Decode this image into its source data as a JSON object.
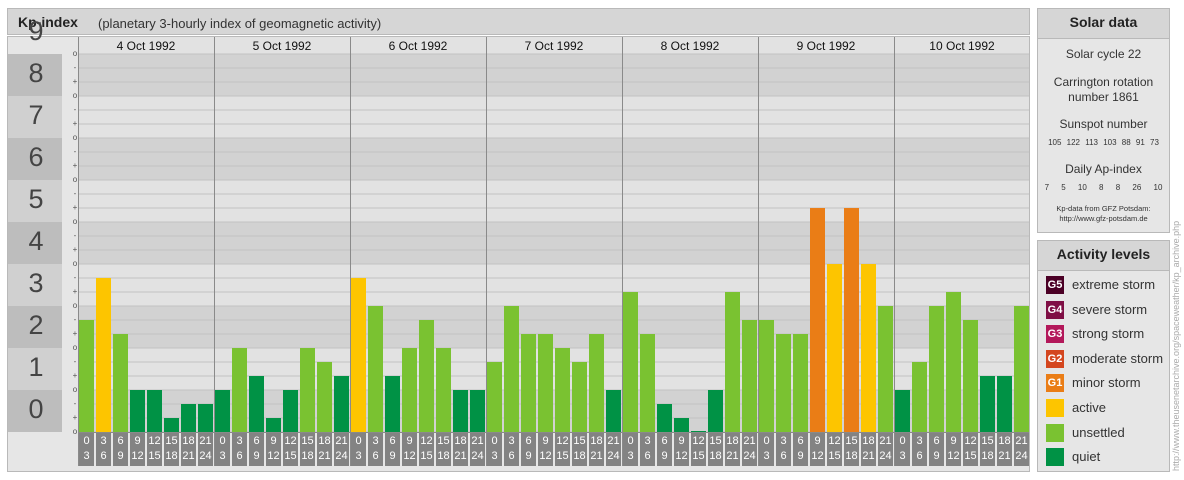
{
  "header": {
    "title": "Kp-index",
    "subtitle": "(planetary 3-hourly index of geomagnetic activity)"
  },
  "chart_data": {
    "type": "bar",
    "y_levels": [
      "0",
      "1",
      "2",
      "3",
      "4",
      "5",
      "6",
      "7",
      "8",
      "9"
    ],
    "subticks": [
      "o",
      "+",
      "-",
      "o",
      "+",
      "-",
      "o",
      "+",
      "-",
      "o",
      "+",
      "-",
      "o",
      "+",
      "-",
      "o",
      "+",
      "-",
      "o",
      "+",
      "-",
      "o",
      "+",
      "-",
      "o",
      "+",
      "-",
      "o"
    ],
    "ylim": [
      0,
      9
    ],
    "days": [
      "4 Oct 1992",
      "5 Oct 1992",
      "6 Oct 1992",
      "7 Oct 1992",
      "8 Oct 1992",
      "9 Oct 1992",
      "10 Oct 1992"
    ],
    "hour_labels": [
      [
        "0",
        "3"
      ],
      [
        "3",
        "6"
      ],
      [
        "6",
        "9"
      ],
      [
        "9",
        "12"
      ],
      [
        "12",
        "15"
      ],
      [
        "15",
        "18"
      ],
      [
        "18",
        "21"
      ],
      [
        "21",
        "24"
      ]
    ],
    "values": [
      [
        2.667,
        3.667,
        2.333,
        1.0,
        1.0,
        0.333,
        0.667,
        0.667
      ],
      [
        1.0,
        2.0,
        1.333,
        0.333,
        1.0,
        2.0,
        1.667,
        1.333
      ],
      [
        3.667,
        3.0,
        1.333,
        2.0,
        2.667,
        2.0,
        1.0,
        1.0
      ],
      [
        1.667,
        3.0,
        2.333,
        2.333,
        2.0,
        1.667,
        2.333,
        1.0
      ],
      [
        3.333,
        2.333,
        0.667,
        0.333,
        0.0,
        1.0,
        3.333,
        2.667
      ],
      [
        2.667,
        2.333,
        2.333,
        5.333,
        4.0,
        5.333,
        4.0,
        3.0
      ],
      [
        1.0,
        1.667,
        3.0,
        3.333,
        2.667,
        1.333,
        1.333,
        3.0
      ]
    ],
    "colors": {
      "quiet": "#009245",
      "unsettled": "#7ac231",
      "active": "#fdc500",
      "minor": "#ea7d16",
      "moderate": "#d4461e",
      "strong": "#b3185a",
      "severe": "#7f0f45",
      "extreme": "#4b0025"
    }
  },
  "solar": {
    "title": "Solar data",
    "cycle": "Solar cycle 22",
    "carrington": "Carrington rotation number 1861",
    "sunspot_title": "Sunspot number",
    "sunspots": "105 122 113 103 88 91 73",
    "ap_title": "Daily Ap-index",
    "ap": "7 5 10 8 8 26 10",
    "source": "Kp-data from GFZ Potsdam: http://www.gfz-potsdam.de"
  },
  "legend": {
    "title": "Activity levels",
    "items": [
      {
        "code": "G5",
        "label": "extreme storm",
        "color": "#4b0025"
      },
      {
        "code": "G4",
        "label": "severe storm",
        "color": "#7f0f45"
      },
      {
        "code": "G3",
        "label": "strong storm",
        "color": "#b3185a"
      },
      {
        "code": "G2",
        "label": "moderate storm",
        "color": "#d4461e"
      },
      {
        "code": "G1",
        "label": "minor storm",
        "color": "#ea7d16"
      },
      {
        "code": "",
        "label": "active",
        "color": "#fdc500"
      },
      {
        "code": "",
        "label": "unsettled",
        "color": "#7ac231"
      },
      {
        "code": "",
        "label": "quiet",
        "color": "#009245"
      }
    ]
  },
  "credit": "http://www.theusenetarchive.org/spaceweather/kp_archive.php"
}
